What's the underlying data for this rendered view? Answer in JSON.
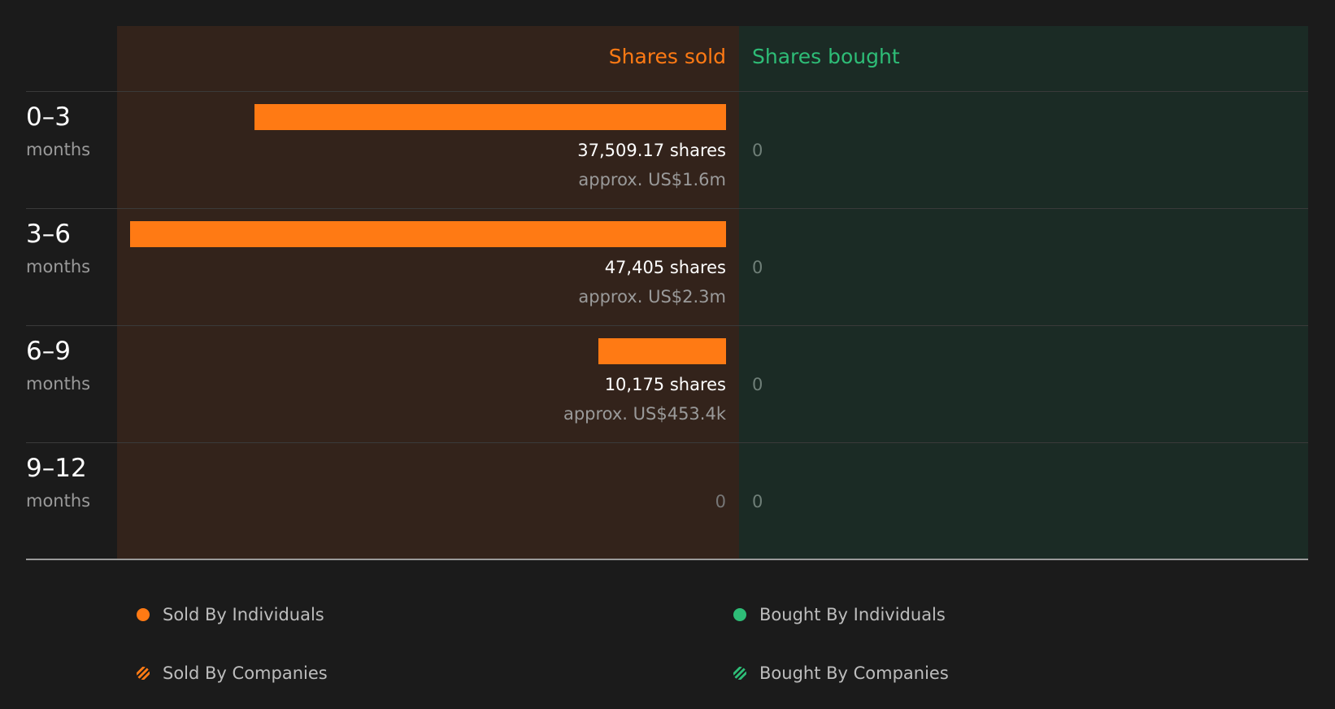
{
  "colors": {
    "sold": "#ff7a14",
    "bought": "#2ebd77",
    "sold_panel_bg": "#33231b",
    "bought_panel_bg": "#1b2b25"
  },
  "chart_data": {
    "type": "bar",
    "orientation": "horizontal-diverging",
    "headers": {
      "sold": "Shares sold",
      "bought": "Shares bought"
    },
    "unit_label": "shares",
    "periods": [
      {
        "range": "0–3",
        "unit": "months",
        "sold": 37509.17,
        "sold_shares_label": "37,509.17 shares",
        "sold_value_label": "approx. US$1.6m",
        "bought": 0,
        "bought_shares_label": "0"
      },
      {
        "range": "3–6",
        "unit": "months",
        "sold": 47405,
        "sold_shares_label": "47,405 shares",
        "sold_value_label": "approx. US$2.3m",
        "bought": 0,
        "bought_shares_label": "0"
      },
      {
        "range": "6–9",
        "unit": "months",
        "sold": 10175,
        "sold_shares_label": "10,175 shares",
        "sold_value_label": "approx. US$453.4k",
        "bought": 0,
        "bought_shares_label": "0"
      },
      {
        "range": "9–12",
        "unit": "months",
        "sold": 0,
        "sold_shares_label": "0",
        "sold_value_label": "",
        "bought": 0,
        "bought_shares_label": "0"
      }
    ],
    "sold_max": 47405,
    "legend": [
      {
        "label": "Sold By Individuals",
        "style": "solid",
        "color": "#ff7a14"
      },
      {
        "label": "Bought By Individuals",
        "style": "solid",
        "color": "#2ebd77"
      },
      {
        "label": "Sold By Companies",
        "style": "hatched",
        "color": "#ff7a14"
      },
      {
        "label": "Bought By Companies",
        "style": "hatched",
        "color": "#2ebd77"
      }
    ]
  }
}
